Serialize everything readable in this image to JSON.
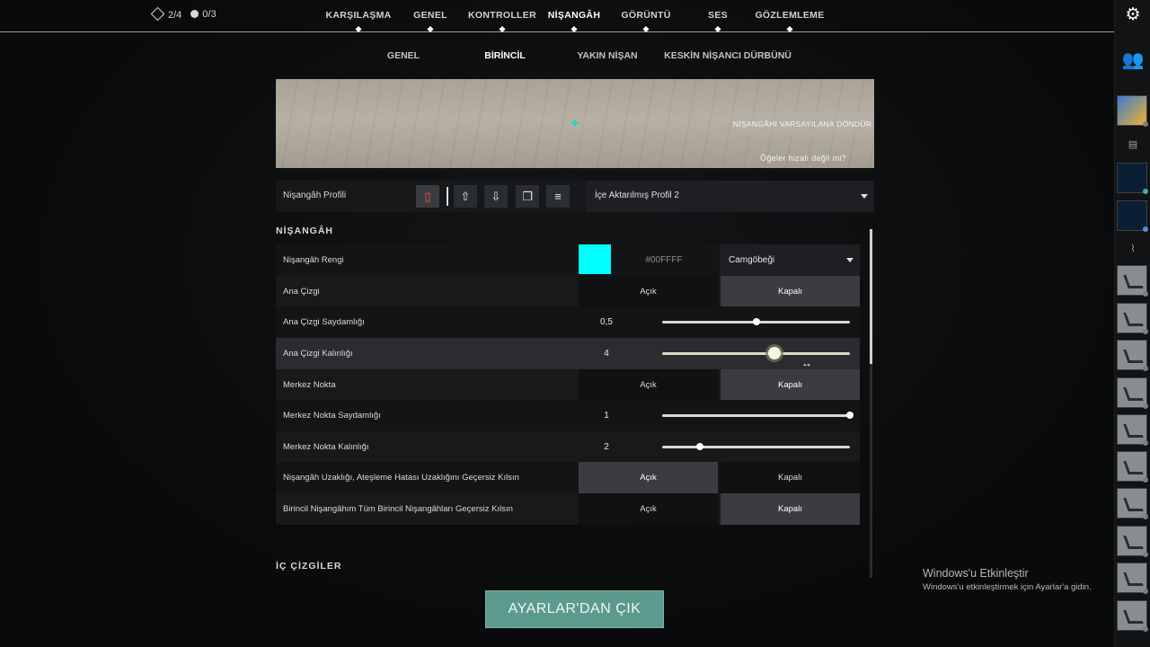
{
  "counters": {
    "missions": "2/4",
    "points": "0/3"
  },
  "tabs": [
    {
      "label": "KARŞILAŞMA",
      "active": false
    },
    {
      "label": "GENEL",
      "active": false
    },
    {
      "label": "KONTROLLER",
      "active": false
    },
    {
      "label": "NİŞANGÂH",
      "active": true
    },
    {
      "label": "GÖRÜNTÜ",
      "active": false
    },
    {
      "label": "SES",
      "active": false
    },
    {
      "label": "GÖZLEMLEME",
      "active": false
    }
  ],
  "subtabs": [
    {
      "label": "GENEL",
      "active": false
    },
    {
      "label": "BİRİNCİL",
      "active": true
    },
    {
      "label": "YAKIN NİŞAN",
      "active": false
    },
    {
      "label": "KESKİN NİŞANCI DÜRBÜNÜ",
      "active": false
    }
  ],
  "preview": {
    "reset_label": "NİŞANGÂHI VARSAYILANA DÖNDÜR",
    "misaligned_label": "Öğeler hizalı değil mi?"
  },
  "profile": {
    "label": "Nişangâh Profili",
    "selected": "İçe Aktarılmış Profil 2"
  },
  "sections": {
    "crosshair": "NİŞANGÂH",
    "inner_lines": "İÇ ÇİZGİLER"
  },
  "settings": {
    "color": {
      "label": "Nişangâh Rengi",
      "hex": "#00FFFF",
      "value": "Camgöbeği",
      "swatch": "#00ffff"
    },
    "outlines": {
      "label": "Ana Çizgi",
      "on": "Açık",
      "off": "Kapalı",
      "selected": "off"
    },
    "outline_opacity": {
      "label": "Ana Çizgi Saydamlığı",
      "value": "0,5",
      "fraction": 0.5
    },
    "outline_thickness": {
      "label": "Ana Çizgi Kalınlığı",
      "value": "4",
      "fraction": 0.6
    },
    "center_dot": {
      "label": "Merkez Nokta",
      "on": "Açık",
      "off": "Kapalı",
      "selected": "off"
    },
    "center_dot_opacity": {
      "label": "Merkez Nokta Saydamlığı",
      "value": "1",
      "fraction": 1.0
    },
    "center_dot_thickness": {
      "label": "Merkez Nokta Kalınlığı",
      "value": "2",
      "fraction": 0.2
    },
    "override_firing_error": {
      "label": "Nişangâh Uzaklığı, Ateşleme Hatası Uzaklığını Geçersiz Kılsın",
      "on": "Açık",
      "off": "Kapalı",
      "selected": "on"
    },
    "override_all_primary": {
      "label": "Birincil Nişangâhım Tüm Birincil Nişangâhları Geçersiz Kılsın",
      "on": "Açık",
      "off": "Kapalı",
      "selected": "off"
    }
  },
  "exit_button": "AYARLAR'DAN ÇIK",
  "windows_activation": {
    "title": "Windows'u Etkinleştir",
    "subtitle": "Windows'u etkinleştirmek için Ayarlar'a gidin."
  },
  "icons": [
    "settings-gear-icon",
    "friends-icon",
    "delete-icon",
    "export-icon",
    "import-icon",
    "copy-icon",
    "rename-icon",
    "chevron-down-icon"
  ],
  "colors": {
    "accent": "#00ffff",
    "exit_button": "#5a9b8e",
    "delete": "#ff4d5a"
  }
}
